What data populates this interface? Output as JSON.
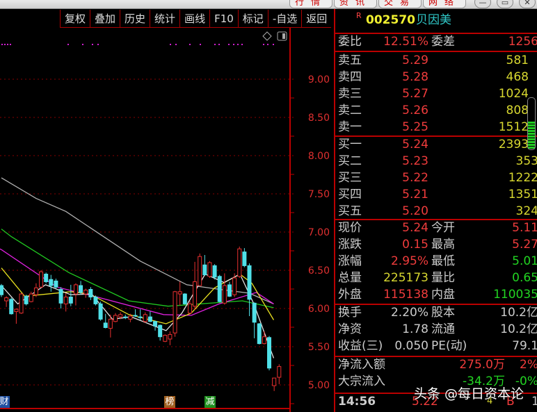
{
  "top_tabs": [
    "行情",
    "资讯",
    "交易",
    "网络"
  ],
  "window_buttons": [
    "minimize",
    "restore",
    "close"
  ],
  "toolbar": [
    "复权",
    "叠加",
    "历史",
    "统计",
    "画线",
    "F10",
    "标记",
    "-自选",
    "返回"
  ],
  "stock": {
    "badge": "R",
    "code": "002570",
    "name": "贝因美"
  },
  "weibi": {
    "label": "委比",
    "value": "12.51%",
    "label2": "委差",
    "value2": "1256"
  },
  "asks": [
    {
      "label": "卖五",
      "price": "5.29",
      "vol": "581"
    },
    {
      "label": "卖四",
      "price": "5.28",
      "vol": "468"
    },
    {
      "label": "卖三",
      "price": "5.27",
      "vol": "1024"
    },
    {
      "label": "卖二",
      "price": "5.26",
      "vol": "808"
    },
    {
      "label": "卖一",
      "price": "5.25",
      "vol": "1512"
    }
  ],
  "bids": [
    {
      "label": "买一",
      "price": "5.24",
      "vol": "2393"
    },
    {
      "label": "买二",
      "price": "5.23",
      "vol": "353"
    },
    {
      "label": "买三",
      "price": "5.22",
      "vol": "1222"
    },
    {
      "label": "买四",
      "price": "5.21",
      "vol": "1351"
    },
    {
      "label": "买五",
      "price": "5.20",
      "vol": "324"
    }
  ],
  "quote": [
    {
      "l1": "现价",
      "v1": "5.24",
      "c1": "r",
      "l2": "今开",
      "v2": "5.11",
      "c2": "r"
    },
    {
      "l1": "涨跌",
      "v1": "0.15",
      "c1": "r",
      "l2": "最高",
      "v2": "5.27",
      "c2": "r"
    },
    {
      "l1": "涨幅",
      "v1": "2.95%",
      "c1": "r",
      "l2": "最低",
      "v2": "5.01",
      "c2": "g"
    },
    {
      "l1": "总量",
      "v1": "225173",
      "c1": "y",
      "l2": "量比",
      "v2": "0.65",
      "c2": "g"
    },
    {
      "l1": "外盘",
      "v1": "115138",
      "c1": "r",
      "l2": "内盘",
      "v2": "110035",
      "c2": "g"
    }
  ],
  "fund": [
    {
      "l1": "换手",
      "v1": "2.20%",
      "l2": "股本",
      "v2": "10.2亿"
    },
    {
      "l1": "净资",
      "v1": "1.78",
      "l2": "流通",
      "v2": "10.2亿"
    },
    {
      "l1": "收益(三)",
      "v1": "0.050",
      "l2": "PE(动)",
      "v2": "79.1"
    }
  ],
  "flow": [
    {
      "label": "净流入额",
      "value": "275.0万",
      "pct": "2%",
      "color": "r"
    },
    {
      "label": "大宗流入",
      "value": "-34.2万",
      "pct": "-0%",
      "color": "g"
    }
  ],
  "tick": {
    "time": "14:56",
    "price": "5.22",
    "vol": "4",
    "side": "B",
    "extra": "1"
  },
  "markers": [
    "财",
    "榜",
    "减"
  ],
  "watermark": "头条 @每日资本论",
  "chart_data": {
    "type": "candlestick",
    "y_ticks": [
      "9.00",
      "8.50",
      "8.00",
      "7.50",
      "7.00",
      "6.50",
      "6.00",
      "5.50",
      "5.00"
    ],
    "ylim": [
      4.9,
      9.6
    ],
    "colors": {
      "up": "#e83030",
      "down": "#50e0e8",
      "ma5": "#e0e0e0",
      "ma10": "#e8e020",
      "ma20": "#e020e0",
      "ma30": "#20c820",
      "ma60": "#b0b0b0"
    },
    "candles": [
      [
        6.3,
        6.18,
        6.32,
        6.15
      ],
      [
        6.1,
        6.14,
        6.16,
        6.02
      ],
      [
        6.12,
        5.93,
        6.14,
        5.92
      ],
      [
        5.96,
        5.99,
        6.0,
        5.8
      ],
      [
        5.94,
        6.19,
        6.2,
        5.93
      ],
      [
        6.16,
        6.06,
        6.18,
        6.04
      ],
      [
        6.09,
        6.19,
        6.22,
        6.08
      ],
      [
        6.18,
        6.27,
        6.33,
        6.15
      ],
      [
        6.28,
        6.48,
        6.5,
        6.27
      ],
      [
        6.45,
        6.35,
        6.47,
        6.33
      ],
      [
        6.38,
        6.3,
        6.44,
        6.22
      ],
      [
        6.36,
        6.28,
        6.39,
        6.26
      ],
      [
        6.25,
        6.07,
        6.28,
        6.0
      ],
      [
        6.06,
        6.15,
        6.2,
        5.96
      ],
      [
        6.15,
        6.07,
        6.31,
        6.03
      ],
      [
        6.19,
        6.31,
        6.33,
        6.04
      ],
      [
        6.3,
        6.21,
        6.36,
        6.18
      ],
      [
        6.19,
        6.24,
        6.26,
        6.14
      ],
      [
        6.25,
        6.15,
        6.28,
        6.11
      ],
      [
        6.15,
        6.06,
        6.17,
        6.04
      ],
      [
        6.06,
        5.86,
        6.09,
        5.84
      ],
      [
        5.81,
        5.75,
        5.93,
        5.74
      ],
      [
        5.74,
        5.86,
        5.92,
        5.62
      ],
      [
        5.83,
        5.91,
        5.94,
        5.82
      ],
      [
        5.89,
        5.92,
        5.95,
        5.86
      ],
      [
        5.89,
        5.88,
        5.92,
        5.86
      ],
      [
        5.86,
        5.9,
        5.93,
        5.82
      ],
      [
        5.91,
        5.9,
        5.99,
        5.89
      ],
      [
        5.89,
        5.88,
        5.99,
        5.85
      ],
      [
        5.83,
        5.92,
        5.95,
        5.81
      ],
      [
        5.89,
        5.83,
        5.96,
        5.82
      ],
      [
        5.83,
        5.77,
        5.84,
        5.71
      ],
      [
        5.78,
        5.63,
        5.79,
        5.58
      ],
      [
        5.57,
        5.65,
        5.66,
        5.56
      ],
      [
        5.6,
        5.66,
        5.7,
        5.52
      ],
      [
        5.68,
        6.22,
        6.23,
        5.63
      ],
      [
        6.19,
        6.22,
        6.35,
        6.04
      ],
      [
        6.19,
        6.06,
        6.2,
        6.05
      ],
      [
        5.94,
        6.06,
        6.1,
        5.92
      ],
      [
        6.03,
        6.35,
        6.61,
        5.98
      ],
      [
        6.3,
        6.68,
        6.72,
        6.3
      ],
      [
        6.57,
        6.44,
        6.7,
        6.43
      ],
      [
        6.42,
        6.6,
        6.62,
        6.4
      ],
      [
        6.56,
        6.41,
        6.58,
        6.38
      ],
      [
        6.42,
        6.09,
        6.44,
        6.08
      ],
      [
        6.07,
        6.3,
        6.46,
        6.05
      ],
      [
        6.31,
        6.16,
        6.35,
        6.15
      ],
      [
        6.18,
        6.4,
        6.46,
        6.15
      ],
      [
        6.42,
        6.78,
        6.81,
        6.4
      ],
      [
        6.74,
        6.56,
        6.79,
        6.54
      ],
      [
        6.56,
        6.12,
        6.59,
        5.9
      ],
      [
        6.07,
        5.82,
        6.08,
        5.61
      ],
      [
        5.8,
        5.54,
        5.81,
        5.53
      ],
      [
        5.54,
        5.63,
        5.7,
        5.53
      ],
      [
        5.62,
        5.22,
        5.64,
        5.19
      ],
      [
        4.99,
        5.09,
        5.09,
        4.92
      ],
      [
        5.1,
        5.24,
        5.27,
        5.01
      ]
    ],
    "ma": {
      "ma5": [
        [
          0,
          6.3
        ],
        [
          3.3,
          6.06
        ],
        [
          8.9,
          6.31
        ],
        [
          14,
          6.18
        ],
        [
          18.2,
          6.19
        ],
        [
          22.4,
          5.86
        ],
        [
          26.2,
          5.89
        ],
        [
          33.2,
          5.71
        ],
        [
          36.4,
          5.94
        ],
        [
          41.1,
          6.45
        ],
        [
          44.9,
          6.34
        ],
        [
          48.1,
          6.45
        ],
        [
          50.9,
          6.06
        ],
        [
          54.9,
          5.35
        ]
      ],
      "ma10": [
        [
          0,
          6.53
        ],
        [
          4.7,
          6.16
        ],
        [
          14,
          6.22
        ],
        [
          17.8,
          6.19
        ],
        [
          25.7,
          5.92
        ],
        [
          33.2,
          5.8
        ],
        [
          38.3,
          5.94
        ],
        [
          43,
          6.27
        ],
        [
          48.1,
          6.45
        ],
        [
          50.5,
          6.33
        ],
        [
          54.9,
          5.85
        ]
      ],
      "ma20": [
        [
          -6,
          6.95
        ],
        [
          0,
          6.77
        ],
        [
          11.2,
          6.28
        ],
        [
          18.7,
          6.16
        ],
        [
          32.7,
          5.92
        ],
        [
          38.3,
          5.91
        ],
        [
          43.9,
          6.06
        ],
        [
          51.4,
          6.21
        ],
        [
          54.9,
          6.06
        ]
      ],
      "ma30": [
        [
          0,
          7.04
        ],
        [
          2,
          6.94
        ],
        [
          13.6,
          6.47
        ],
        [
          25.7,
          6.1
        ],
        [
          33.6,
          6.03
        ],
        [
          48.6,
          6.1
        ],
        [
          54.9,
          6.01
        ]
      ],
      "ma60": [
        [
          0,
          7.71
        ],
        [
          7,
          7.44
        ],
        [
          13,
          7.27
        ],
        [
          20.6,
          6.94
        ],
        [
          28,
          6.62
        ],
        [
          37.4,
          6.31
        ],
        [
          44,
          6.25
        ],
        [
          50,
          6.2
        ],
        [
          54.9,
          6.06
        ]
      ]
    }
  }
}
